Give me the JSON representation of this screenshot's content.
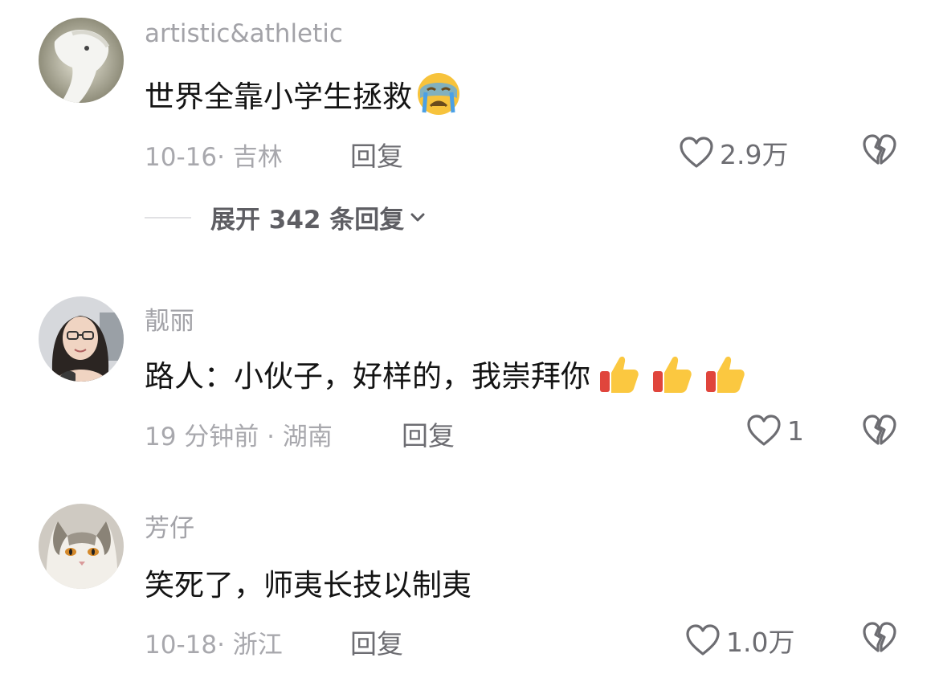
{
  "comments": [
    {
      "username": "artistic&athletic",
      "text": "世界全靠小学生拯救",
      "emoji": "loudly-crying-face",
      "meta": "10-16· 吉林",
      "reply_label": "回复",
      "likes": "2.9万",
      "expand_label": "展开 342 条回复"
    },
    {
      "username": "靓丽",
      "text": "路人：小伙子，好样的，我崇拜你",
      "emoji": "thumbs-up x3",
      "meta": "19 分钟前 · 湖南",
      "reply_label": "回复",
      "likes": "1"
    },
    {
      "username": "芳仔",
      "text": "笑死了，师夷长技以制夷",
      "meta": "10-18· 浙江",
      "reply_label": "回复",
      "likes": "1.0万"
    }
  ],
  "icons": {
    "like": "heart-outline-icon",
    "dislike": "broken-heart-icon",
    "expand": "chevron-down-icon"
  },
  "colors": {
    "username": "#a3a3a8",
    "text": "#141414",
    "meta": "#a8a8ad",
    "action": "#6d6d72"
  }
}
